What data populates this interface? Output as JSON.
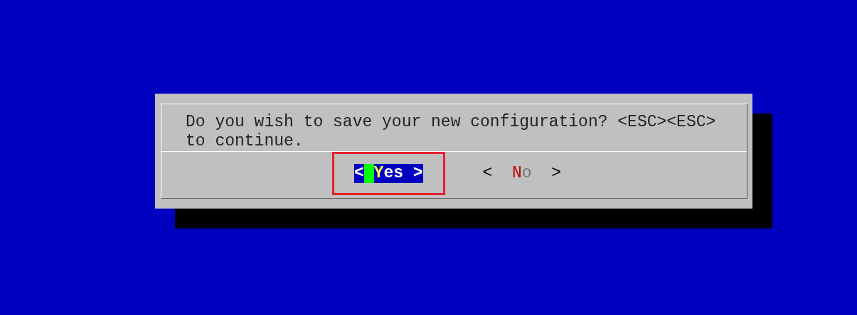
{
  "dialog": {
    "message": "Do you wish to save your new configuration? <ESC><ESC> to continue.",
    "buttons": [
      {
        "open": "<",
        "hotkey": "Y",
        "rest": "es",
        "close": ">",
        "selected": true,
        "highlighted": true
      },
      {
        "open": "<",
        "hotkey": "N",
        "rest": "o",
        "close": ">",
        "selected": false,
        "highlighted": false
      }
    ]
  }
}
